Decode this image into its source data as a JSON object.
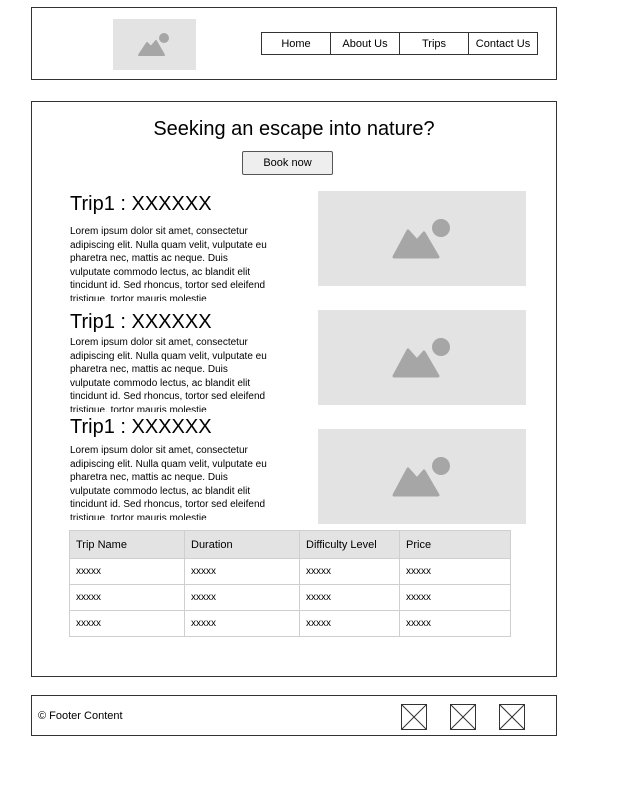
{
  "header": {
    "logo_icon": "image-placeholder-icon",
    "nav": [
      {
        "label": "Home"
      },
      {
        "label": "About Us"
      },
      {
        "label": "Trips"
      },
      {
        "label": "Contact Us"
      }
    ]
  },
  "main": {
    "headline": "Seeking an escape into nature?",
    "book_button": "Book now",
    "trips": [
      {
        "title": "Trip1 : XXXXXX",
        "description": "Lorem ipsum dolor sit amet, consectetur adipiscing elit. Nulla quam velit, vulputate eu pharetra nec, mattis ac neque. Duis vulputate commodo lectus, ac blandit elit tincidunt id. Sed rhoncus, tortor sed eleifend tristique, tortor mauris molestie",
        "image_icon": "image-placeholder-icon"
      },
      {
        "title": "Trip1 : XXXXXX",
        "description": "Lorem ipsum dolor sit amet, consectetur adipiscing elit. Nulla quam velit, vulputate eu pharetra nec, mattis ac neque. Duis vulputate commodo lectus, ac blandit elit tincidunt id. Sed rhoncus, tortor sed eleifend tristique, tortor mauris molestie",
        "image_icon": "image-placeholder-icon"
      },
      {
        "title": "Trip1 : XXXXXX",
        "description": "Lorem ipsum dolor sit amet, consectetur adipiscing elit. Nulla quam velit, vulputate eu pharetra nec, mattis ac neque. Duis vulputate commodo lectus, ac blandit elit tincidunt id. Sed rhoncus, tortor sed eleifend tristique, tortor mauris molestie",
        "image_icon": "image-placeholder-icon"
      }
    ],
    "table": {
      "headers": [
        "Trip Name",
        "Duration",
        "Difficulty Level",
        "Price"
      ],
      "rows": [
        [
          "xxxxx",
          "xxxxx",
          "xxxxx",
          "xxxxx"
        ],
        [
          "xxxxx",
          "xxxxx",
          "xxxxx",
          "xxxxx"
        ],
        [
          "xxxxx",
          "xxxxx",
          "xxxxx",
          "xxxxx"
        ]
      ]
    }
  },
  "footer": {
    "text": "© Footer Content",
    "social_icons": [
      "social-icon-placeholder",
      "social-icon-placeholder",
      "social-icon-placeholder"
    ]
  },
  "colors": {
    "placeholder_bg": "#e3e3e3",
    "placeholder_fg": "#a6a6a6",
    "border": "#333333"
  }
}
